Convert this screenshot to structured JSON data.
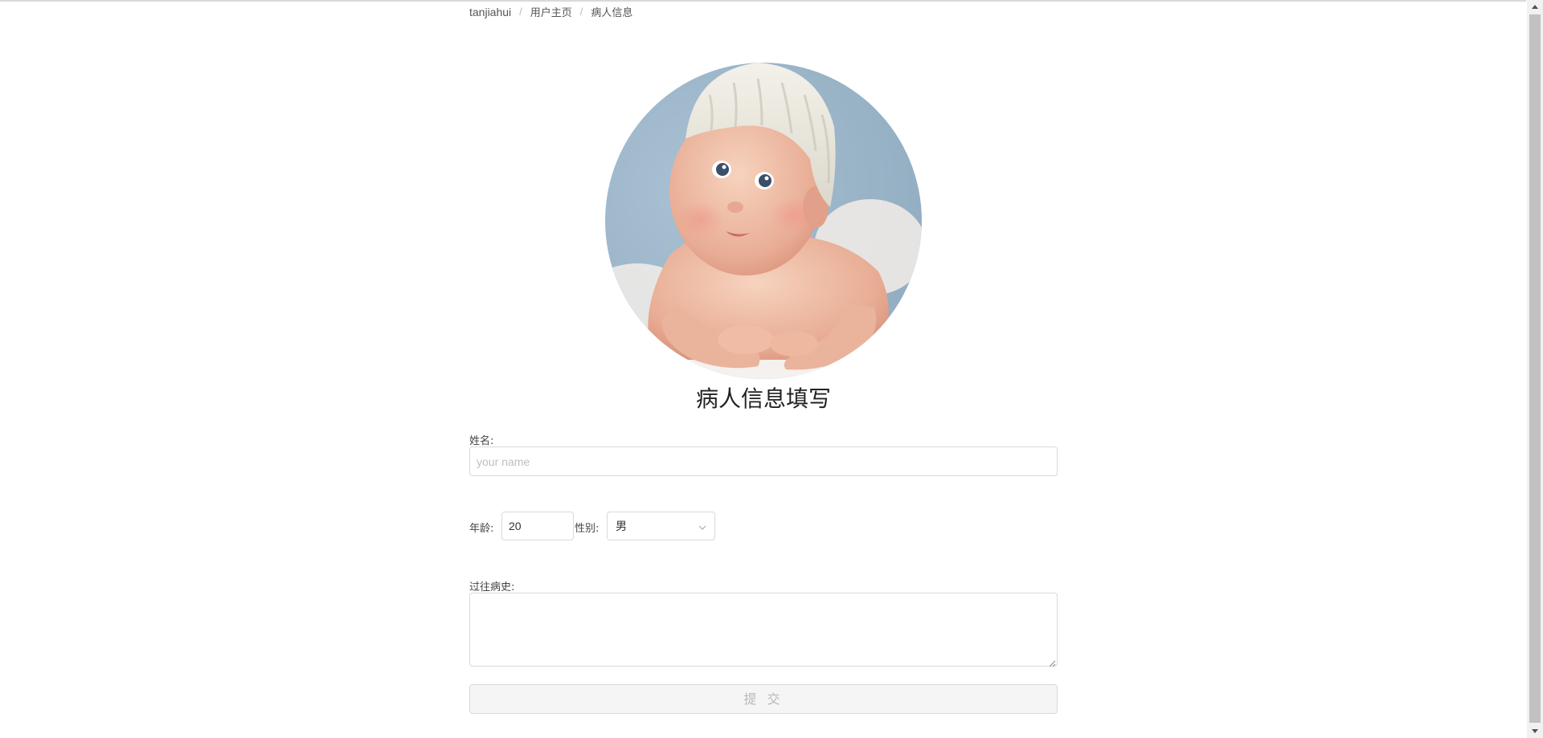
{
  "breadcrumb": {
    "items": [
      "tanjiahui",
      "用户主页",
      "病人信息"
    ],
    "separator": "/"
  },
  "form": {
    "title": "病人信息填写",
    "name_label": "姓名:",
    "name_placeholder": "your name",
    "name_value": "",
    "age_label": "年龄:",
    "age_value": "20",
    "gender_label": "性别:",
    "gender_value": "男",
    "history_label": "过往病史:",
    "history_value": "",
    "submit_label": "提 交"
  },
  "colors": {
    "border": "#d9d9d9",
    "submit_bg": "#f5f5f5",
    "submit_text": "#b8b8b8"
  },
  "icons": {
    "select_arrow": "chevron-down-icon",
    "scroll_up": "triangle-up-icon",
    "scroll_down": "triangle-down-icon"
  }
}
